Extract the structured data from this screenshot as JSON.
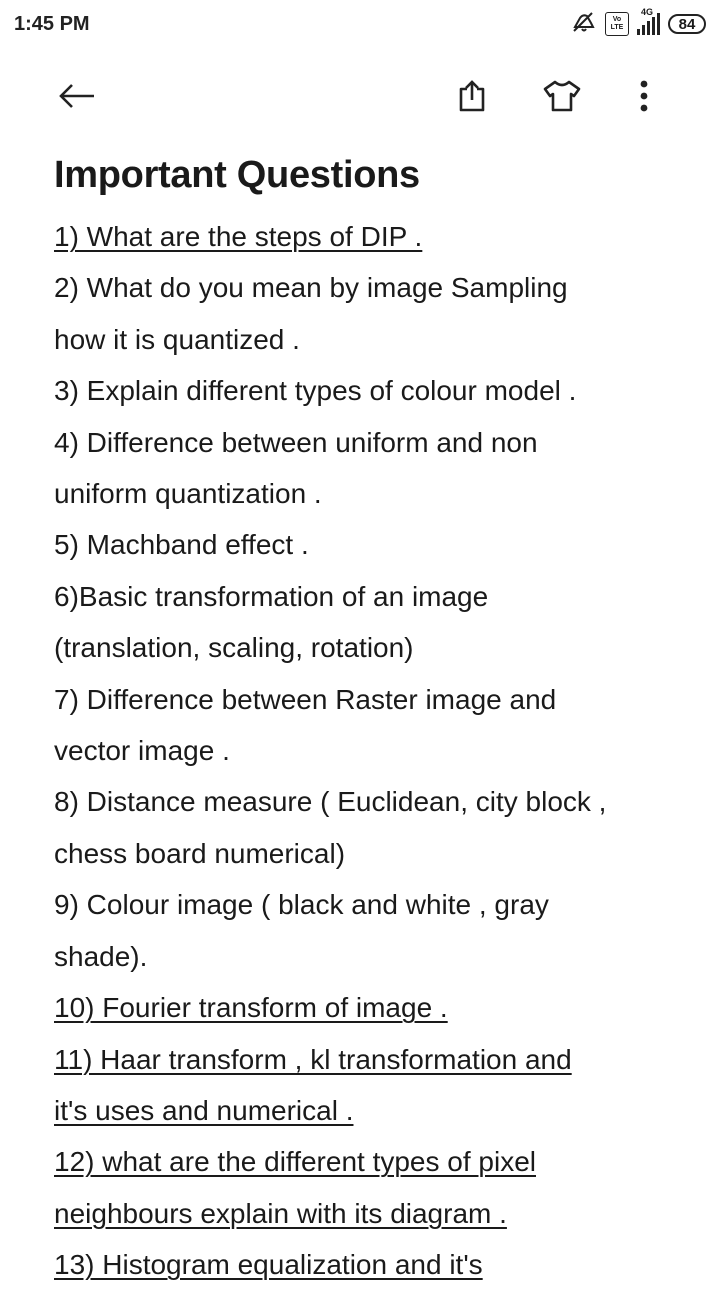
{
  "status_bar": {
    "time": "1:45 PM",
    "network": "4G",
    "volte_top": "Vo",
    "volte_bottom": "LTE",
    "battery": "84"
  },
  "toolbar": {
    "back_icon": "arrow-left-icon",
    "share_icon": "share-icon",
    "theme_icon": "shirt-icon",
    "more_icon": "more-vert-icon"
  },
  "note": {
    "title": "Important Questions",
    "lines": [
      "1) What are the steps of DIP .",
      "2) What do you mean by image Sampling",
      "how it is quantized .",
      "3) Explain different types of colour model .",
      "4) Difference between uniform and non",
      "uniform quantization .",
      "5) Machband effect .",
      "6)Basic transformation of an image",
      "(translation, scaling, rotation)",
      "7) Difference between Raster image and",
      "vector image .",
      "8) Distance measure ( Euclidean, city block ,",
      "chess board numerical)",
      "9) Colour image ( black and white , gray",
      "shade).",
      "10) Fourier transform of image .",
      "11) Haar transform , kl transformation  and",
      "it's uses and numerical .",
      "12) what are the different types of pixel",
      "neighbours explain with its diagram .",
      "13) Histogram equalization  and it's"
    ]
  }
}
